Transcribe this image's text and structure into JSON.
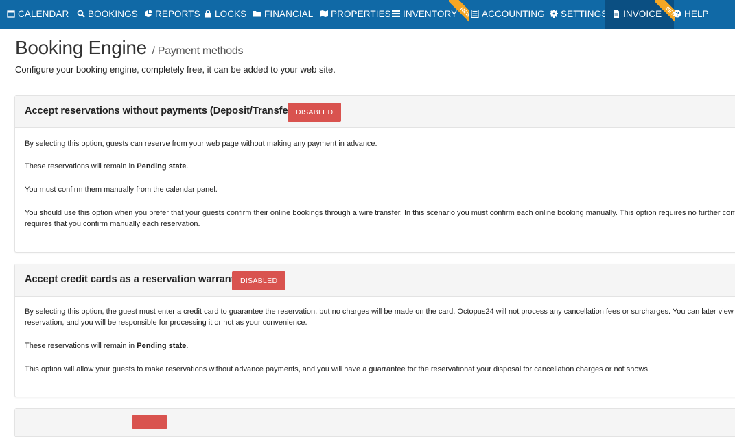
{
  "nav": {
    "items": [
      {
        "label": "CALENDAR",
        "icon": "calendar-icon"
      },
      {
        "label": "BOOKINGS",
        "icon": "search-icon"
      },
      {
        "label": "REPORTS",
        "icon": "pie-chart-icon"
      },
      {
        "label": "LOCKS",
        "icon": "lock-icon"
      },
      {
        "label": "FINANCIAL",
        "icon": "folder-icon"
      },
      {
        "label": "PROPERTIES",
        "icon": "map-icon"
      },
      {
        "label": "INVENTORY",
        "icon": "list-icon"
      },
      {
        "label": "ACCOUNTING",
        "icon": "calculator-icon"
      },
      {
        "label": "SETTINGS",
        "icon": "gear-icon"
      },
      {
        "label": "INVOICE",
        "icon": "document-icon"
      },
      {
        "label": "HELP",
        "icon": "question-circle-icon"
      }
    ],
    "ribbon_new": "NEW",
    "ribbon_beta": "BETA"
  },
  "page": {
    "title": "Booking Engine",
    "subtitle": "/ Payment methods",
    "description": "Configure your booking engine, completely free, it can be added to your web site."
  },
  "panels": [
    {
      "title": "Accept reservations without payments (Deposit/Transfer)",
      "status": "DISABLED",
      "p1": "By selecting this option, guests can reserve from your web page without making any payment in advance.",
      "p2_pre": "These reservations will remain in ",
      "p2_bold": "Pending state",
      "p2_post": ".",
      "p3": "You must confirm them manually from the calendar panel.",
      "p4a": "You should use this option when you prefer that your guests confirm their online bookings through a wire transfer. In this scenario you must confirm each online booking manually. This option requires no further configuration",
      "p4b": "requires that you confirm manually each reservation."
    },
    {
      "title": "Accept credit cards as a reservation warranty",
      "status": "DISABLED",
      "p1a": "By selecting this option, the guest must enter a credit card to guarantee the reservation, but no charges will be made on the card. Octopus24 will not process any cancellation fees or surcharges. You can later view the card",
      "p1b": "reservation, and you will be responsible for processing it or not as your convenience.",
      "p2_pre": "These reservations will remain in ",
      "p2_bold": "Pending state",
      "p2_post": ".",
      "p3": "This option will allow your guests to make reservations without advance payments, and you will have a guarrantee for the reservationat your disposal for cancellation charges or not shows."
    }
  ],
  "colors": {
    "nav_bg": "#1069a6",
    "nav_active": "#0b4f82",
    "badge": "#d9534f",
    "ribbon": "#f5a623"
  }
}
